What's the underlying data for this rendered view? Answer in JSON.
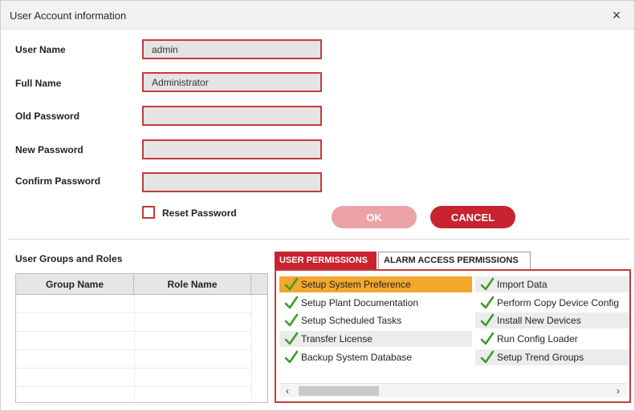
{
  "window": {
    "title": "User Account information",
    "close_glyph": "×"
  },
  "form": {
    "user_name": {
      "label": "User Name",
      "value": "admin"
    },
    "full_name": {
      "label": "Full Name",
      "value": "Administrator"
    },
    "old_password": {
      "label": "Old Password",
      "value": ""
    },
    "new_password": {
      "label": "New Password",
      "value": ""
    },
    "confirm_password": {
      "label": "Confirm Password",
      "value": ""
    },
    "reset_password": {
      "label": "Reset Password",
      "checked": false
    }
  },
  "buttons": {
    "ok": "OK",
    "cancel": "CANCEL"
  },
  "groups": {
    "section_label": "User Groups and Roles",
    "columns": [
      "Group Name",
      "Role Name"
    ],
    "rows": []
  },
  "tabs": {
    "user_permissions": "USER PERMISSIONS",
    "alarm_access_permissions": "ALARM ACCESS PERMISSIONS",
    "active": "user_permissions"
  },
  "permissions": {
    "left": [
      {
        "label": "Setup System Preference",
        "checked": true,
        "selected": true
      },
      {
        "label": "Setup Plant Documentation",
        "checked": true
      },
      {
        "label": "Setup Scheduled Tasks",
        "checked": true
      },
      {
        "label": "Transfer License",
        "checked": true
      },
      {
        "label": "Backup System Database",
        "checked": true
      }
    ],
    "right": [
      {
        "label": "Import Data",
        "checked": true
      },
      {
        "label": "Perform Copy Device Config",
        "checked": true
      },
      {
        "label": "Install New Devices",
        "checked": true
      },
      {
        "label": "Run Config Loader",
        "checked": true
      },
      {
        "label": "Setup Trend Groups",
        "checked": true
      }
    ]
  },
  "scrollbar": {
    "left_arrow": "‹",
    "right_arrow": "›"
  },
  "colors": {
    "accent_red": "#c8232f",
    "ok_disabled": "#eba3a8",
    "selection_orange": "#f3a72c",
    "check_green": "#3f9a2a"
  }
}
